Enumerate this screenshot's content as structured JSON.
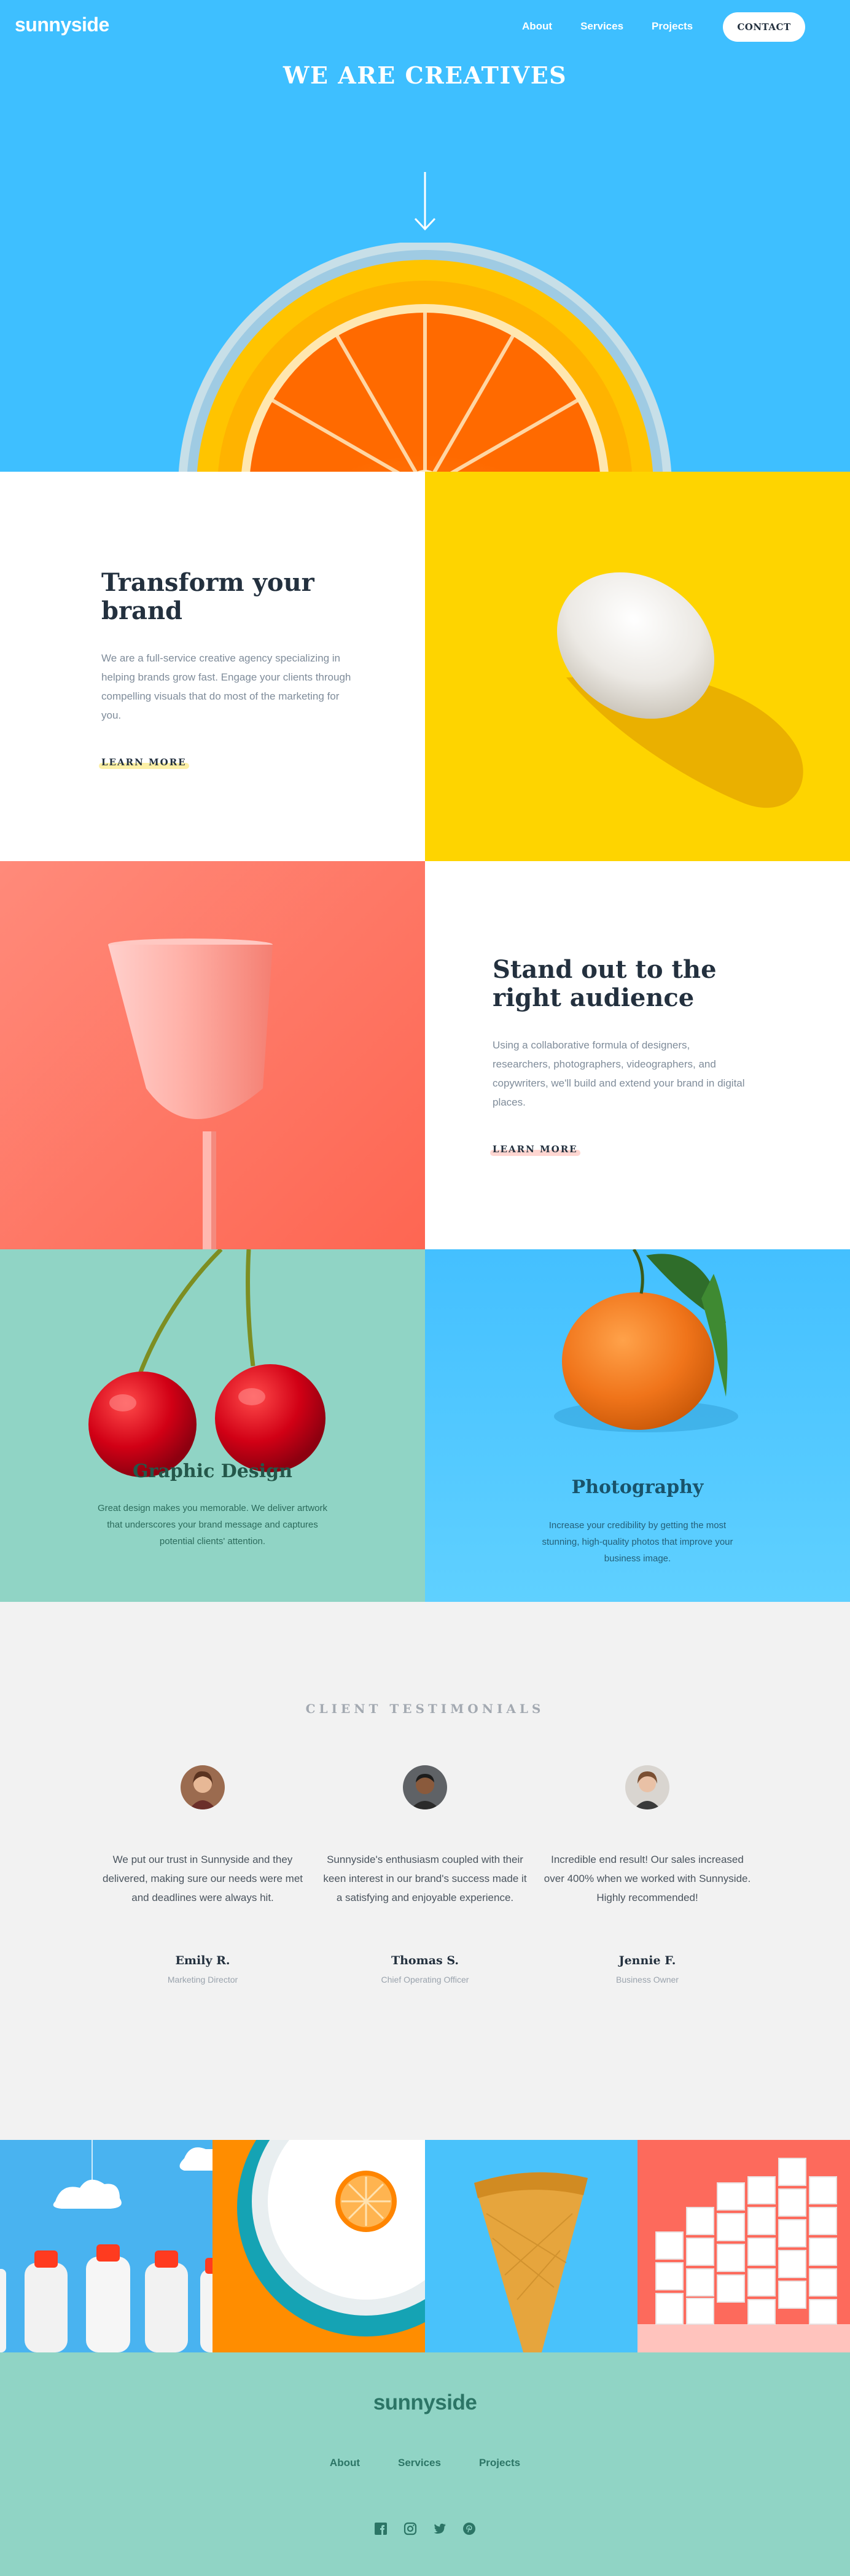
{
  "header": {
    "logo": "sunnyside",
    "nav": [
      "About",
      "Services",
      "Projects"
    ],
    "contact_label": "CONTACT"
  },
  "hero": {
    "title": "WE ARE CREATIVES",
    "arrow_icon": "arrow-down-icon"
  },
  "features": [
    {
      "title": "Transform your brand",
      "text": "We are a full-service creative agency specializing in helping brands grow fast. Engage your clients through compelling visuals that do most of the marketing for you.",
      "link": "LEARN MORE",
      "highlight_color": "#fad400"
    },
    {
      "title": "Stand out to the right audience",
      "text": "Using a collaborative formula of designers, researchers, photographers, videographers, and copywriters, we'll build and extend your brand in digital places.",
      "link": "LEARN MORE",
      "highlight_color": "#fe7766"
    }
  ],
  "services": [
    {
      "title": "Graphic Design",
      "text": "Great design makes you memorable. We deliver artwork that underscores your brand message and captures potential clients' attention.",
      "color": "#24574a"
    },
    {
      "title": "Photography",
      "text": "Increase your credibility by getting the most stunning, high-quality photos that improve your business image.",
      "color": "#19536b"
    }
  ],
  "testimonials": {
    "heading": "CLIENT TESTIMONIALS",
    "items": [
      {
        "quote": "We put our trust in Sunnyside and they delivered, making sure our needs were met and deadlines were always hit.",
        "name": "Emily R.",
        "role": "Marketing Director"
      },
      {
        "quote": "Sunnyside's enthusiasm coupled with their keen interest in our brand's success made it a satisfying and enjoyable experience.",
        "name": "Thomas S.",
        "role": "Chief Operating Officer"
      },
      {
        "quote": "Incredible end result! Our sales increased over 400% when we worked with Sunnyside. Highly recommended!",
        "name": "Jennie F.",
        "role": "Business Owner"
      }
    ]
  },
  "footer": {
    "logo": "sunnyside",
    "nav": [
      "About",
      "Services",
      "Projects"
    ],
    "social_icons": [
      "facebook-icon",
      "instagram-icon",
      "twitter-icon",
      "pinterest-icon"
    ]
  },
  "colors": {
    "hero_bg": "#3ebfff",
    "yellow": "#fed400",
    "coral": "#fe7766",
    "mint": "#90d4c5",
    "dark_text": "#23303e",
    "footer_text": "#2c7566"
  }
}
